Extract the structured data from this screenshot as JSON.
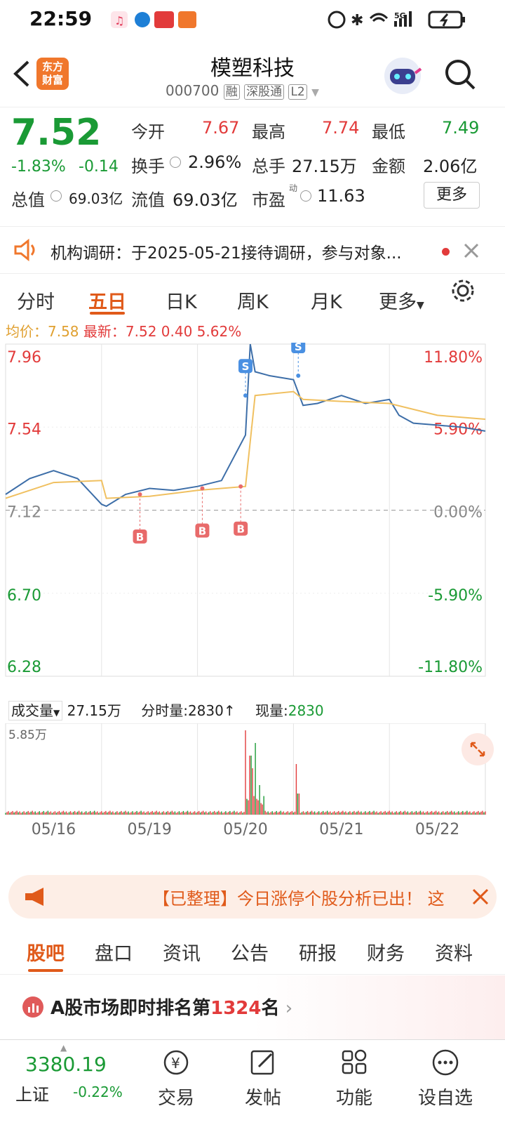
{
  "status": {
    "time": "22:59"
  },
  "header": {
    "logo": "东方\n财富",
    "logo_l1": "东方",
    "logo_l2": "财富",
    "title": "模塑科技",
    "code": "000700",
    "tag1": "融",
    "tag2": "深股通",
    "tag3": "L2"
  },
  "quote": {
    "price": "7.52",
    "change_pct": "-1.83%",
    "change": "-0.14",
    "open_label": "今开",
    "open": "7.67",
    "high_label": "最高",
    "high": "7.74",
    "low_label": "最低",
    "low": "7.49",
    "turnover_label": "换手",
    "turnover": "2.96%",
    "volume_label": "总手",
    "volume": "27.15万",
    "amount_label": "金额",
    "amount": "2.06亿",
    "mktcap_label": "总值",
    "mktcap": "69.03亿",
    "float_label": "流值",
    "float": "69.03亿",
    "pe_label": "市盈",
    "pe_sup": "动",
    "pe": "11.63",
    "more_button": "更多"
  },
  "research_banner": {
    "text": "机构调研：于2025-05-21接待调研，参与对象..."
  },
  "tabs": [
    "分时",
    "五日",
    "日K",
    "周K",
    "月K",
    "更多"
  ],
  "active_tab": 1,
  "chart_info": {
    "avg_label": "均价：",
    "avg": "7.58",
    "latest_label": "最新：",
    "latest": "7.52",
    "chg": "0.40",
    "pct": "5.62%"
  },
  "chart_data": {
    "type": "line",
    "y_left_ticks": [
      "7.96",
      "7.54",
      "7.12",
      "6.70",
      "6.28"
    ],
    "y_right_ticks": [
      "11.80%",
      "5.90%",
      "0.00%",
      "-5.90%",
      "-11.80%"
    ],
    "ylim": [
      6.28,
      7.96
    ],
    "x_labels": [
      "05/16",
      "05/19",
      "05/20",
      "05/21",
      "05/22"
    ],
    "series": [
      {
        "name": "最新",
        "color": "#3d6ea8",
        "x": [
          0,
          0.05,
          0.1,
          0.15,
          0.2,
          0.21,
          0.25,
          0.3,
          0.35,
          0.4,
          0.45,
          0.5,
          0.51,
          0.52,
          0.55,
          0.6,
          0.62,
          0.65,
          0.7,
          0.75,
          0.8,
          0.82,
          0.85,
          0.9,
          0.95,
          1.0
        ],
        "values": [
          7.2,
          7.28,
          7.32,
          7.28,
          7.15,
          7.14,
          7.2,
          7.23,
          7.22,
          7.24,
          7.27,
          7.5,
          7.96,
          7.82,
          7.8,
          7.78,
          7.65,
          7.66,
          7.7,
          7.66,
          7.68,
          7.6,
          7.56,
          7.55,
          7.54,
          7.52
        ]
      },
      {
        "name": "均价",
        "color": "#f0c060",
        "x": [
          0,
          0.1,
          0.2,
          0.21,
          0.3,
          0.4,
          0.5,
          0.52,
          0.6,
          0.62,
          0.7,
          0.8,
          0.9,
          1.0
        ],
        "values": [
          7.18,
          7.26,
          7.27,
          7.18,
          7.19,
          7.22,
          7.24,
          7.7,
          7.72,
          7.68,
          7.67,
          7.66,
          7.6,
          7.58
        ]
      }
    ],
    "markers": [
      {
        "label": "B",
        "x": 0.28,
        "price": 7.2
      },
      {
        "label": "B",
        "x": 0.41,
        "price": 7.23
      },
      {
        "label": "B",
        "x": 0.49,
        "price": 7.24
      },
      {
        "label": "S",
        "x": 0.5,
        "price": 7.7
      },
      {
        "label": "S",
        "x": 0.61,
        "price": 7.8
      }
    ]
  },
  "volume": {
    "label": "成交量",
    "total": "27.15万",
    "tick_label": "分时量:2830",
    "now_label": "现量:",
    "now": "2830",
    "max": "5.85万"
  },
  "promo": {
    "text": "【已整理】今日涨停个股分析已出！ 这"
  },
  "section_tabs": [
    "股吧",
    "盘口",
    "资讯",
    "公告",
    "研报",
    "财务",
    "资料"
  ],
  "ranking": {
    "prefix": "A股市场即时排名第",
    "rank": "1324",
    "suffix": "名"
  },
  "footer": {
    "index_value": "3380.19",
    "index_name": "上证",
    "index_change": "-0.22%",
    "items": [
      "交易",
      "发帖",
      "功能",
      "设自选"
    ]
  }
}
